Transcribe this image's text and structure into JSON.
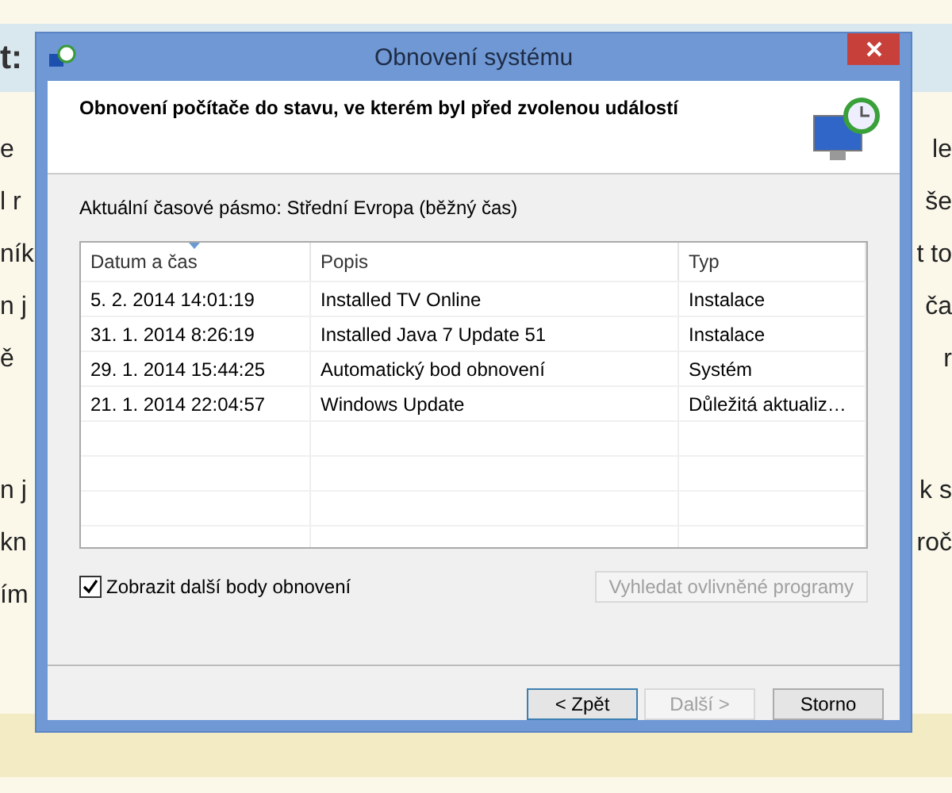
{
  "page": {
    "heading": "t:",
    "paragraphs": [
      [
        {
          "left": "e",
          "right": "le"
        },
        {
          "left": "l r",
          "right": "še"
        },
        {
          "left": "ník",
          "right": "t to"
        },
        {
          "left": "n j",
          "right": "ča"
        },
        {
          "left": "ě",
          "right": "r"
        }
      ],
      [
        {
          "left": "n j",
          "right": "k s"
        },
        {
          "left": "kn",
          "right": "roč"
        },
        {
          "left": "ím"
        }
      ]
    ]
  },
  "dialog": {
    "title": "Obnovení systému",
    "header": "Obnovení počítače do stavu, ve kterém byl před zvolenou událostí",
    "timezone": "Aktuální časové pásmo: Střední Evropa (běžný čas)",
    "table": {
      "columns": [
        {
          "label": "Datum a čas",
          "sorted": true
        },
        {
          "label": "Popis",
          "sorted": false
        },
        {
          "label": "Typ",
          "sorted": false
        }
      ],
      "rows": [
        [
          "5. 2. 2014 14:01:19",
          "Installed TV Online",
          "Instalace"
        ],
        [
          "31. 1. 2014 8:26:19",
          "Installed Java 7 Update 51",
          "Instalace"
        ],
        [
          "29. 1. 2014 15:44:25",
          "Automatický bod obnovení",
          "Systém"
        ],
        [
          "21. 1. 2014 22:04:57",
          "Windows Update",
          "Důležitá aktualiz…"
        ]
      ]
    },
    "show_more": {
      "label": "Zobrazit další body obnovení",
      "checked": true
    },
    "find_button": {
      "label": "Vyhledat ovlivněné programy",
      "disabled": true
    },
    "buttons": [
      {
        "label": "< Zpět",
        "disabled": false,
        "default": true
      },
      {
        "label": "Další >",
        "disabled": true,
        "default": false
      },
      {
        "label": "Storno",
        "disabled": false,
        "default": false
      }
    ]
  }
}
